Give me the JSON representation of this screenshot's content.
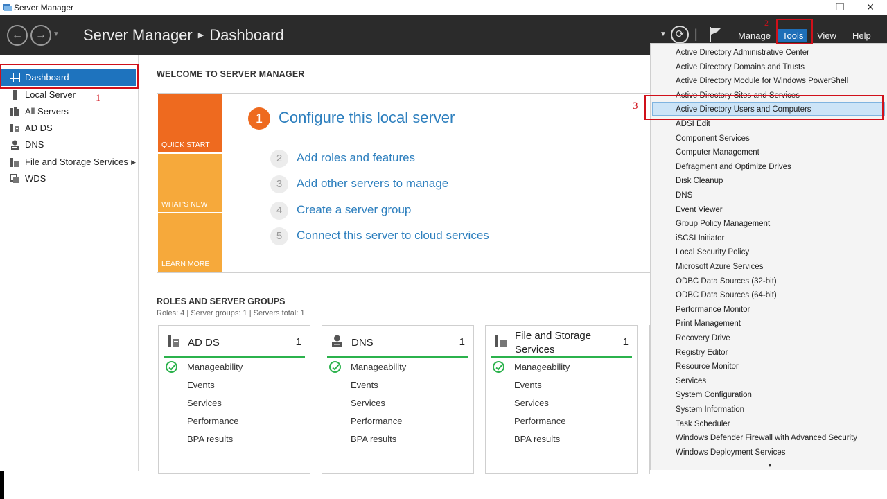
{
  "window": {
    "title": "Server Manager",
    "minimize": "—",
    "restore": "❐",
    "close": "✕"
  },
  "header": {
    "back_glyph": "←",
    "forward_glyph": "→",
    "app": "Server Manager",
    "separator": "▶",
    "page": "Dashboard",
    "menu": {
      "manage": "Manage",
      "tools": "Tools",
      "view": "View",
      "help": "Help"
    },
    "refresh_glyph": "⟳"
  },
  "annotations": {
    "one": "1",
    "two": "2",
    "three": "3",
    "accent_red": "#d0101a"
  },
  "sidebar": {
    "items": [
      {
        "label": "Dashboard",
        "icon": "dashboard-icon"
      },
      {
        "label": "Local Server",
        "icon": "local-server-icon"
      },
      {
        "label": "All Servers",
        "icon": "all-servers-icon"
      },
      {
        "label": "AD DS",
        "icon": "ad-ds-icon"
      },
      {
        "label": "DNS",
        "icon": "dns-icon"
      },
      {
        "label": "File and Storage Services",
        "icon": "file-storage-icon"
      },
      {
        "label": "WDS",
        "icon": "wds-icon"
      }
    ],
    "chevron": "▶"
  },
  "welcome": {
    "title": "WELCOME TO SERVER MANAGER",
    "tiles": {
      "quick_start": "QUICK START",
      "whats_new": "WHAT'S NEW",
      "learn_more": "LEARN MORE"
    },
    "step1": {
      "num": "1",
      "label": "Configure this local server"
    },
    "steps": [
      {
        "num": "2",
        "label": "Add roles and features"
      },
      {
        "num": "3",
        "label": "Add other servers to manage"
      },
      {
        "num": "4",
        "label": "Create a server group"
      },
      {
        "num": "5",
        "label": "Connect this server to cloud services"
      }
    ]
  },
  "roles": {
    "title": "ROLES AND SERVER GROUPS",
    "subtitle": "Roles: 4   |   Server groups: 1   |   Servers total: 1",
    "cards": [
      {
        "title": "AD DS",
        "title2": "",
        "count": "1"
      },
      {
        "title": "DNS",
        "title2": "",
        "count": "1"
      },
      {
        "title": "File and Storage",
        "title2": "Services",
        "count": "1"
      }
    ],
    "rows": [
      "Manageability",
      "Events",
      "Services",
      "Performance",
      "BPA results"
    ]
  },
  "tools_menu": {
    "items": [
      "Active Directory Administrative Center",
      "Active Directory Domains and Trusts",
      "Active Directory Module for Windows PowerShell",
      "Active Directory Sites and Services",
      "Active Directory Users and Computers",
      "ADSI Edit",
      "Component Services",
      "Computer Management",
      "Defragment and Optimize Drives",
      "Disk Cleanup",
      "DNS",
      "Event Viewer",
      "Group Policy Management",
      "iSCSI Initiator",
      "Local Security Policy",
      "Microsoft Azure Services",
      "ODBC Data Sources (32-bit)",
      "ODBC Data Sources (64-bit)",
      "Performance Monitor",
      "Print Management",
      "Recovery Drive",
      "Registry Editor",
      "Resource Monitor",
      "Services",
      "System Configuration",
      "System Information",
      "Task Scheduler",
      "Windows Defender Firewall with Advanced Security",
      "Windows Deployment Services"
    ],
    "highlighted_index": 4,
    "scroll_glyph": "▼"
  },
  "colors": {
    "header_bg": "#2b2b2b",
    "accent_blue": "#1e73be",
    "orange": "#ee6a1f",
    "link_blue": "#2d7fbe",
    "green": "#2bb24c"
  }
}
